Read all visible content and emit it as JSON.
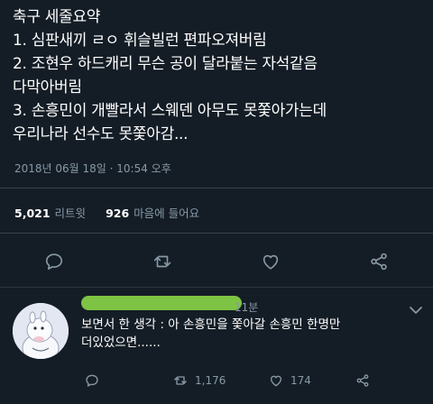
{
  "tweet": {
    "text": "축구 세줄요약\n1. 심판새끼 ㄹㅇ 휘슬빌런 편파오져버림\n2. 조현우 하드캐리 무슨 공이 달라붙는 자석같음\n다막아버림\n3. 손흥민이 개빨라서 스웨덴 아무도 못쫓아가는데\n우리나라 선수도 못쫓아감...",
    "timestamp": "2018년 06월 18일 · 10:54 오후"
  },
  "stats": {
    "retweets_count": "5,021",
    "retweets_label": "리트윗",
    "likes_count": "926",
    "likes_label": "마음에 들어요"
  },
  "actions": {
    "icons": [
      "reply-icon",
      "retweet-icon",
      "like-icon",
      "share-icon"
    ]
  },
  "reply": {
    "time": "11분",
    "text": "보면서 한 생각 : 아 손흥민을 쫓아갈 손흥민 한명만\n더있었으면......",
    "retweet_count": "1,176",
    "like_count": "174"
  },
  "colors": {
    "background": "#141d26",
    "divider": "#38444d",
    "muted_text": "#8899a6",
    "text": "#ffffff",
    "redaction": "#8fe04a"
  }
}
